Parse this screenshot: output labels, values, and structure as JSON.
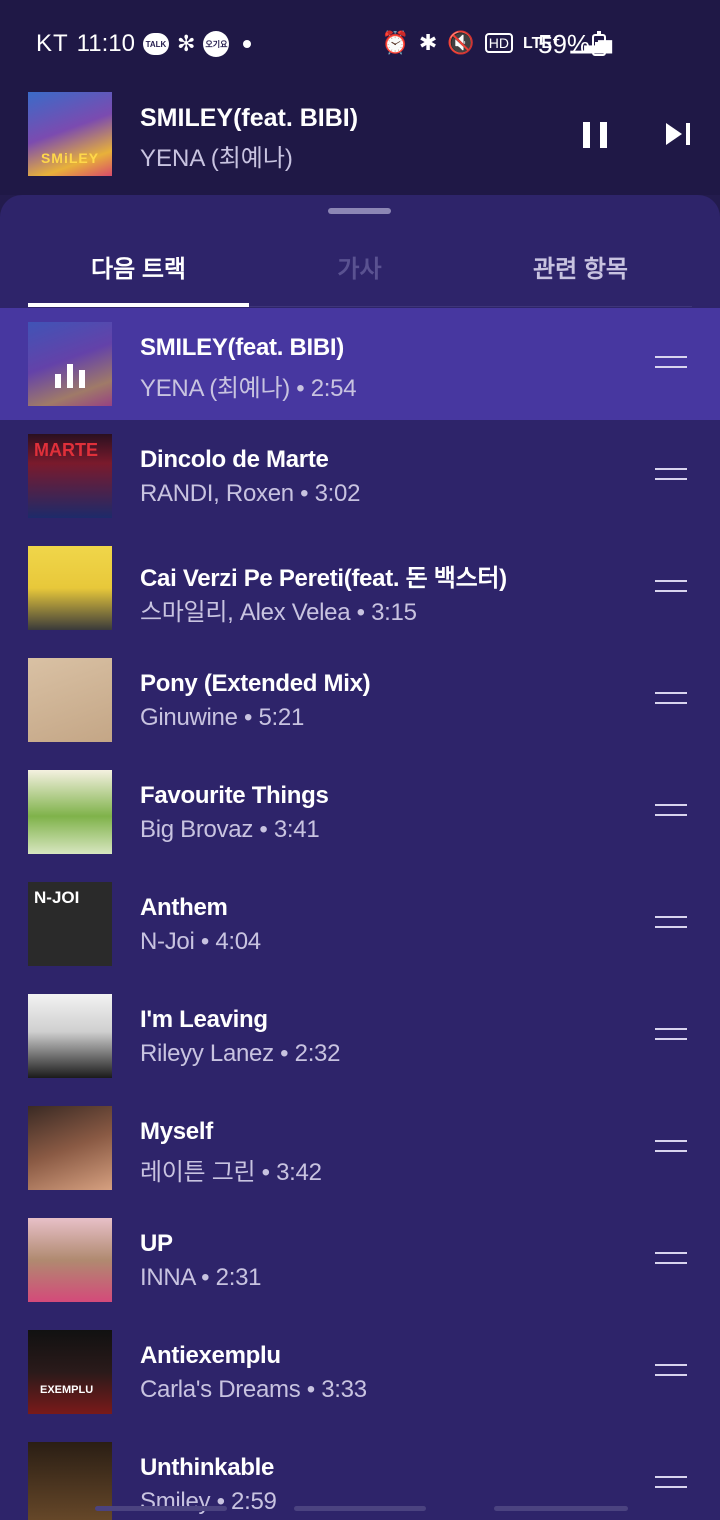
{
  "status_bar": {
    "carrier": "KT",
    "time": "11:10",
    "talk_badge": "TALK",
    "circle_badge": "오기요",
    "battery_percent": "59%",
    "lte": "LTE⁺"
  },
  "now_playing": {
    "title": "SMILEY(feat. BIBI)",
    "artist": "YENA (최예나)",
    "art_text": "SMiLEY"
  },
  "tabs": [
    {
      "label": "다음 트랙",
      "active": true
    },
    {
      "label": "가사",
      "active": false
    },
    {
      "label": "관련 항목",
      "active": false
    }
  ],
  "tracks": [
    {
      "title": "SMILEY(feat. BIBI)",
      "meta": "YENA (최예나) • 2:54",
      "playing": true
    },
    {
      "title": "Dincolo de Marte",
      "meta": "RANDI, Roxen • 3:02",
      "art_label": "MARTE"
    },
    {
      "title": "Cai Verzi Pe Pereti(feat. 돈 백스터)",
      "meta": "스마일리, Alex Velea • 3:15"
    },
    {
      "title": "Pony (Extended Mix)",
      "meta": "Ginuwine • 5:21"
    },
    {
      "title": "Favourite Things",
      "meta": "Big Brovaz • 3:41"
    },
    {
      "title": "Anthem",
      "meta": "N-Joi • 4:04",
      "art_label": "N-JOI"
    },
    {
      "title": "I'm Leaving",
      "meta": "Rileyy Lanez • 2:32"
    },
    {
      "title": "Myself",
      "meta": "레이튼 그린 • 3:42"
    },
    {
      "title": "UP",
      "meta": "INNA • 2:31"
    },
    {
      "title": "Antiexemplu",
      "meta": "Carla's Dreams • 3:33",
      "art_label": "EXEMPLU"
    },
    {
      "title": "Unthinkable",
      "meta": "Smiley • 2:59"
    }
  ]
}
